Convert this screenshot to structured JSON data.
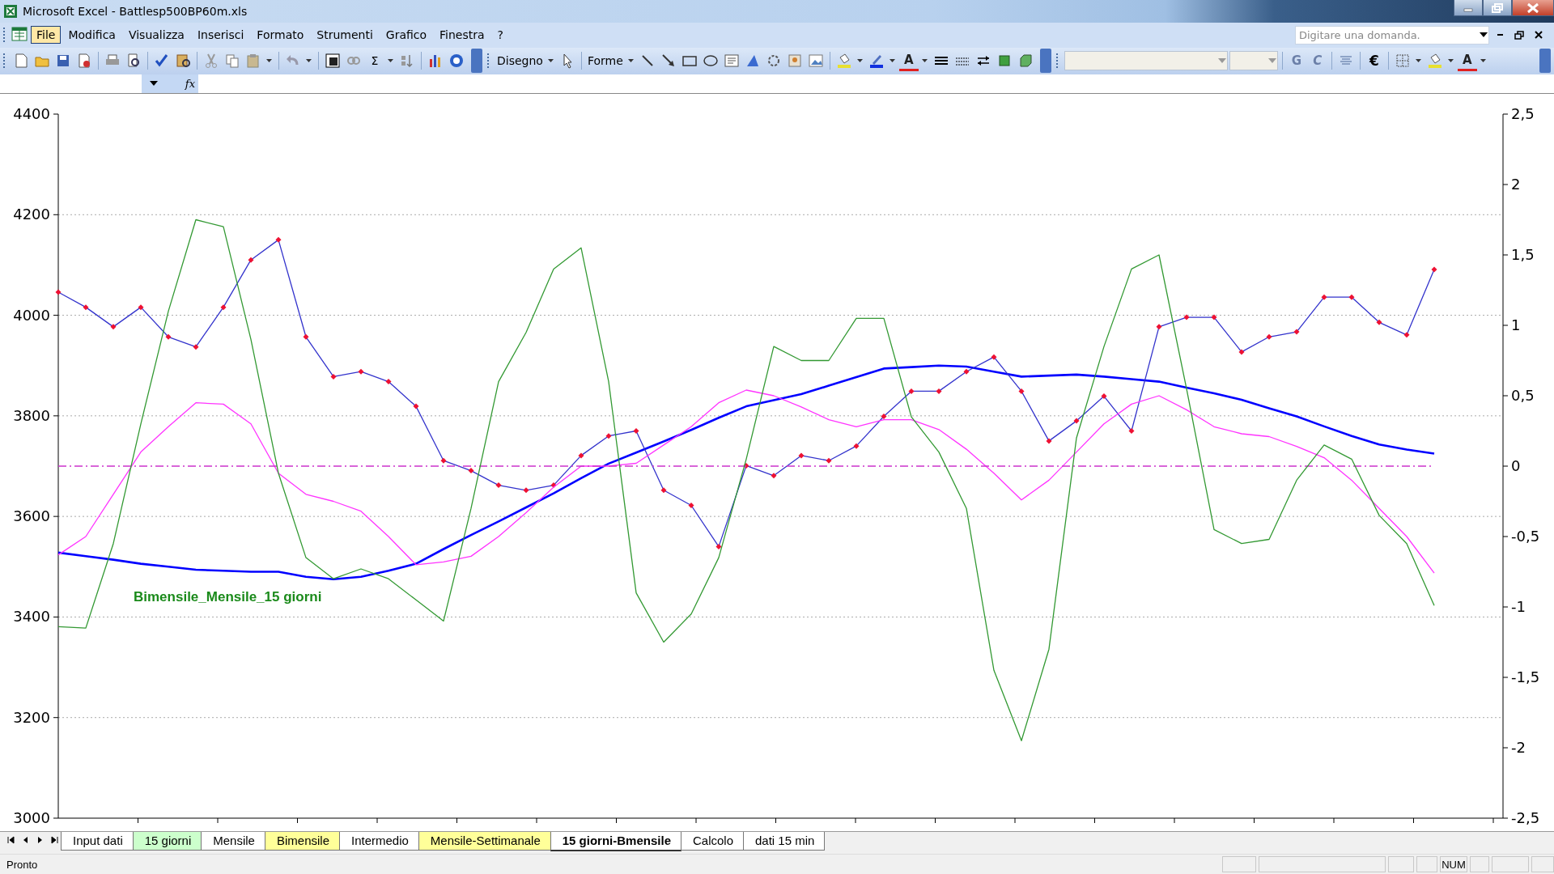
{
  "window": {
    "title": "Microsoft Excel - Battlesp500BP60m.xls"
  },
  "menu": [
    {
      "label": "File",
      "selected": true
    },
    {
      "label": "Modifica",
      "selected": false
    },
    {
      "label": "Visualizza",
      "selected": false
    },
    {
      "label": "Inserisci",
      "selected": false
    },
    {
      "label": "Formato",
      "selected": false
    },
    {
      "label": "Strumenti",
      "selected": false
    },
    {
      "label": "Grafico",
      "selected": false
    },
    {
      "label": "Finestra",
      "selected": false
    },
    {
      "label": "?",
      "selected": false
    }
  ],
  "help_box": {
    "placeholder": "Digitare una domanda."
  },
  "toolbar": {
    "autosum": "Σ",
    "drawing_menu": "Disegno",
    "shapes_menu": "Forme",
    "drawing_font_color": "A",
    "bold": "G",
    "italic": "C",
    "currency": "€",
    "font_color": "A"
  },
  "formula_bar": {
    "function_label": "fx"
  },
  "charts": [
    {
      "chart_data": {
        "type": "line",
        "grid": true,
        "ylim": [
          3000,
          4400
        ],
        "yticks": [
          3000,
          3200,
          3400,
          3600,
          3800,
          4000,
          4200,
          4400
        ],
        "categories": [
          null,
          null,
          null,
          null,
          null,
          null,
          null,
          null,
          null,
          null,
          null,
          null,
          null,
          null,
          null,
          null,
          null,
          null,
          null,
          null,
          null,
          null,
          null,
          null,
          null,
          null,
          null,
          null,
          null,
          null,
          null,
          null,
          null,
          null,
          null,
          null,
          null,
          null,
          null,
          null,
          null,
          null,
          null,
          null,
          null,
          null,
          null,
          null,
          null,
          null,
          null
        ],
        "series": [
          {
            "color": "#0000ff",
            "marker": "none",
            "values": [
              3528,
              3521,
              3514,
              3506,
              3500,
              3494,
              3492,
              3490,
              3490,
              3480,
              3475,
              3480,
              3492,
              3506,
              3535,
              3563,
              3590,
              3618,
              3646,
              3676,
              3705,
              3727,
              3749,
              3772,
              3796,
              3819,
              3831,
              3843,
              3860,
              3877,
              3894,
              3897,
              3900,
              3898,
              3888,
              3878,
              3880,
              3882,
              3878,
              3873,
              3868,
              3856,
              3845,
              3832,
              3815,
              3799,
              3779,
              3760,
              3743,
              3733,
              3725
            ]
          },
          {
            "color": "#3333cc",
            "marker": "diamond",
            "values": [
              4046,
              4016,
              3977,
              4016,
              3957,
              3937,
              4016,
              4110,
              4150,
              3957,
              3878,
              3888,
              3868,
              3819,
              3711,
              3691,
              3662,
              3652,
              3662,
              3721,
              3760,
              3770,
              3652,
              3622,
              3540,
              3701,
              3681,
              3721,
              3711,
              3740,
              3799,
              3849,
              3849,
              3888,
              3917,
              3849,
              3750,
              3790,
              3839,
              3770,
              3977,
              3996,
              3996,
              3927,
              3957,
              3967,
              4036,
              4036,
              3986,
              3961,
              4091
            ]
          }
        ]
      }
    },
    {
      "chart_data": {
        "type": "line",
        "ylim": [
          -2.5,
          2.5
        ],
        "yticks": [
          {
            "value": -2.5,
            "label": "-2,5"
          },
          {
            "value": -2,
            "label": "-2"
          },
          {
            "value": -1.5,
            "label": "-1,5"
          },
          {
            "value": -1,
            "label": "-1"
          },
          {
            "value": -0.5,
            "label": "-0,5"
          },
          {
            "value": 0,
            "label": "0"
          },
          {
            "value": 0.5,
            "label": "0,5"
          },
          {
            "value": 1,
            "label": "1"
          },
          {
            "value": 1.5,
            "label": "1,5"
          },
          {
            "value": 2,
            "label": "2"
          },
          {
            "value": 2.5,
            "label": "2,5"
          }
        ],
        "categories": [
          null,
          null,
          null,
          null,
          null,
          null,
          null,
          null,
          null,
          null,
          null,
          null,
          null,
          null,
          null,
          null,
          null,
          null,
          null,
          null,
          null,
          null,
          null,
          null,
          null,
          null,
          null,
          null,
          null,
          null,
          null,
          null,
          null,
          null,
          null,
          null,
          null,
          null,
          null,
          null,
          null,
          null,
          null,
          null,
          null,
          null,
          null,
          null,
          null,
          null,
          null
        ],
        "series": [
          {
            "color": "#ff33ff",
            "marker": "none",
            "values": [
              -0.63,
              -0.5,
              -0.2,
              0.1,
              0.28,
              0.45,
              0.44,
              0.3,
              -0.05,
              -0.2,
              -0.25,
              -0.32,
              -0.5,
              -0.7,
              -0.68,
              -0.64,
              -0.5,
              -0.33,
              -0.15,
              0,
              0,
              0.02,
              0.15,
              0.28,
              0.45,
              0.54,
              0.5,
              0.42,
              0.33,
              0.28,
              0.33,
              0.33,
              0.26,
              0.12,
              -0.05,
              -0.24,
              -0.1,
              0.1,
              0.3,
              0.44,
              0.5,
              0.4,
              0.28,
              0.23,
              0.21,
              0.14,
              0.06,
              -0.1,
              -0.3,
              -0.5,
              -0.76
            ]
          },
          {
            "color": "#cc33cc",
            "marker": "none",
            "line_style": "dashdot",
            "values": [
              0,
              0,
              0,
              0,
              0,
              0,
              0,
              0,
              0,
              0,
              0,
              0,
              0,
              0,
              0,
              0,
              0,
              0,
              0,
              0,
              0,
              0,
              0,
              0,
              0,
              0,
              0,
              0,
              0,
              0,
              0,
              0,
              0,
              0,
              0,
              0,
              0,
              0,
              0,
              0,
              0,
              0,
              0,
              0,
              0,
              0,
              0,
              0,
              0,
              0,
              0
            ]
          },
          {
            "color": "#339933",
            "marker": "none",
            "values": [
              -1.14,
              -1.15,
              -0.55,
              0.3,
              1.1,
              1.75,
              1.7,
              0.9,
              -0.05,
              -0.65,
              -0.8,
              -0.73,
              -0.8,
              -0.95,
              -1.1,
              -0.3,
              0.6,
              0.95,
              1.4,
              1.55,
              0.6,
              -0.9,
              -1.25,
              -1.05,
              -0.65,
              0.05,
              0.85,
              0.75,
              0.75,
              1.05,
              1.05,
              0.35,
              0.1,
              -0.3,
              -1.45,
              -1.95,
              -1.3,
              0.2,
              0.85,
              1.4,
              1.5,
              0.55,
              -0.45,
              -0.55,
              -0.52,
              -0.1,
              0.15,
              0.05,
              -0.35,
              -0.55,
              -0.99
            ]
          }
        ],
        "annotations": [
          {
            "text": "Bimensile_Mensile_15 giorni"
          }
        ]
      }
    }
  ],
  "sheet_tabs": [
    {
      "label": "Input dati",
      "selected": false,
      "color": "#ffffff"
    },
    {
      "label": "15 giorni",
      "selected": false,
      "color": "#ccffcc"
    },
    {
      "label": "Mensile",
      "selected": false,
      "color": "#ffffff"
    },
    {
      "label": "Bimensile",
      "selected": false,
      "color": "#ffff99"
    },
    {
      "label": "Intermedio",
      "selected": false,
      "color": "#ffffff"
    },
    {
      "label": "Mensile-Settimanale",
      "selected": false,
      "color": "#ffff99"
    },
    {
      "label": "15 giorni-Bmensile",
      "selected": true,
      "color": "#ffffff"
    },
    {
      "label": "Calcolo",
      "selected": false,
      "color": "#ffffff"
    },
    {
      "label": "dati 15 min",
      "selected": false,
      "color": "#ffffff"
    }
  ],
  "status_bar": {
    "text": "Pronto",
    "indicators": [
      "NUM"
    ]
  }
}
